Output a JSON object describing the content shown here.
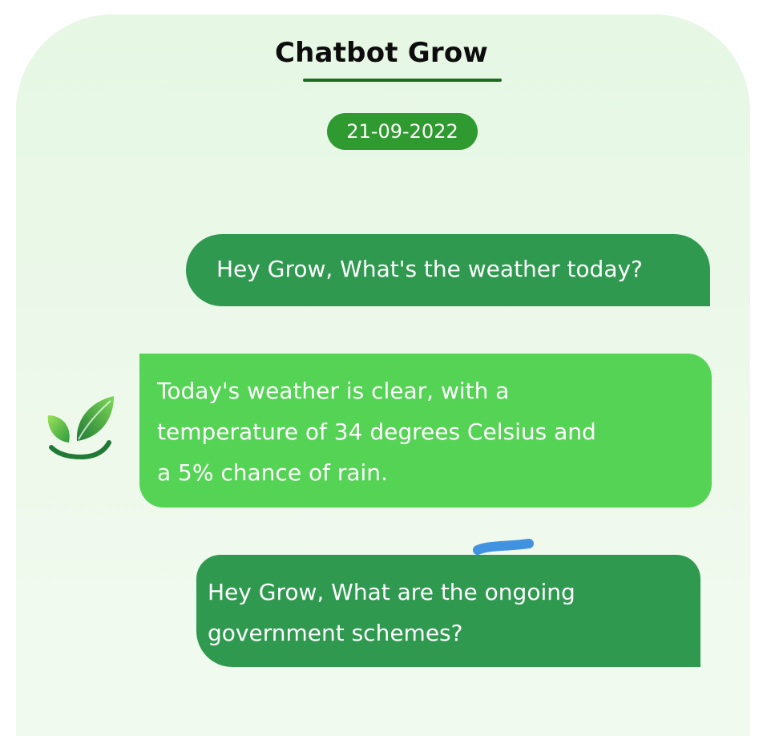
{
  "header": {
    "title": "Chatbot Grow",
    "date": "21-09-2022"
  },
  "messages": [
    {
      "sender": "user",
      "text": "Hey Grow, What's the weather today?"
    },
    {
      "sender": "bot",
      "text": "Today's weather is clear, with a\ntemperature of 34 degrees Celsius and\na 5% chance of rain."
    },
    {
      "sender": "user",
      "text": "Hey Grow, What are the ongoing\ngovernment schemes?"
    }
  ],
  "icons": {
    "bot_avatar": "leaf-bowl-logo-icon"
  },
  "colors": {
    "user_bubble": "#2f9a4f",
    "bot_bubble": "#55d355",
    "date_pill": "#2f9a2f",
    "accent": "#1f6b1f",
    "background": "#e6f7e4"
  }
}
